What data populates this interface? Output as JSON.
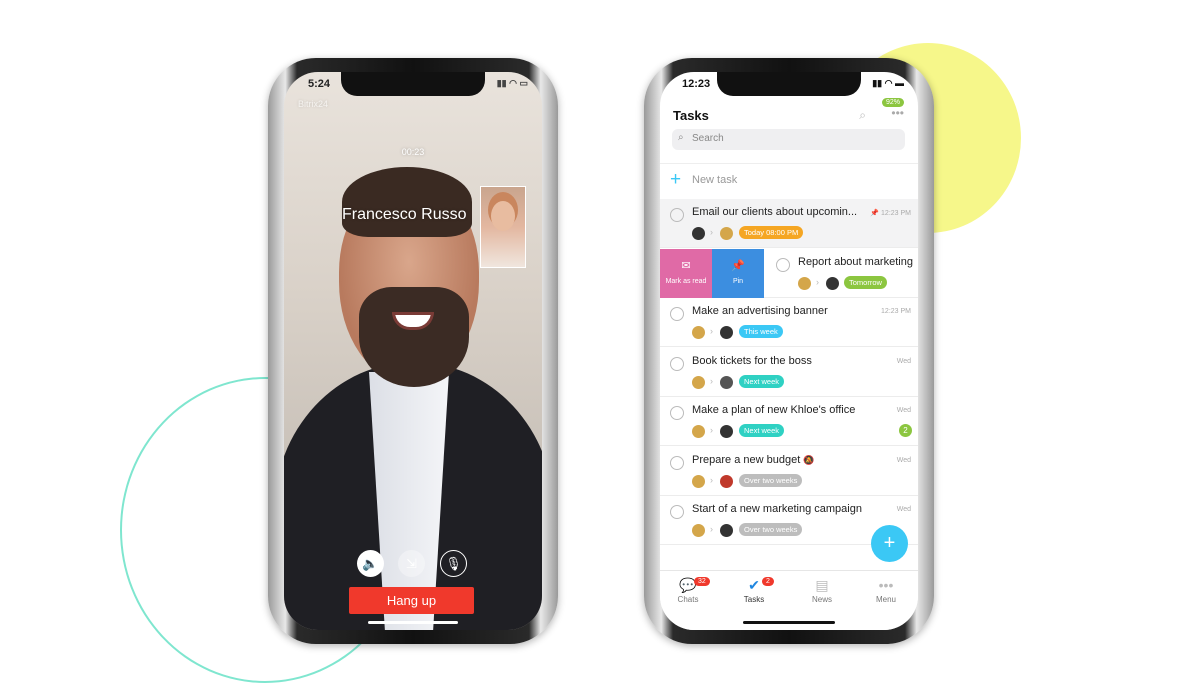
{
  "colors": {
    "accent": "#3bc8f5",
    "hangup": "#f0392c",
    "yellow_deco": "#f6f78a",
    "teal_deco": "#7fe6cf"
  },
  "call": {
    "time": "5:24",
    "app_label": "Bitrix24",
    "duration": "00:23",
    "caller": "Francesco Russo",
    "hangup_label": "Hang up",
    "buttons": [
      {
        "icon": "speaker-icon",
        "glyph": "🔈"
      },
      {
        "icon": "minimize-icon",
        "glyph": "⇲"
      },
      {
        "icon": "microphone-icon",
        "glyph": "🎙"
      }
    ]
  },
  "tasks": {
    "time": "12:23",
    "battery_badge": "92%",
    "title": "Tasks",
    "search_placeholder": "Search",
    "new_task": "New task",
    "swipe_actions": [
      {
        "label": "Mark as read",
        "color": "#e06aa6"
      },
      {
        "label": "Pin",
        "color": "#3c8ee0"
      }
    ],
    "items": [
      {
        "title": "Email our clients about upcomin...",
        "time": "12:23 PM",
        "pinned": true,
        "tag": "Today 08:00 PM",
        "tag_color": "#f5a623"
      },
      {
        "title": "Report about marketing",
        "time": "",
        "tag": "Tomorrow",
        "tag_color": "#8cc640"
      },
      {
        "title": "Make an advertising banner",
        "time": "12:23 PM",
        "tag": "This week",
        "tag_color": "#3bc8f5"
      },
      {
        "title": "Book tickets for the boss",
        "time": "Wed",
        "tag": "Next week",
        "tag_color": "#2fd1c3"
      },
      {
        "title": "Make a plan of new Khloe's office",
        "time": "Wed",
        "tag": "Next week",
        "tag_color": "#2fd1c3",
        "counter": "2"
      },
      {
        "title": "Prepare a new budget",
        "time": "Wed",
        "muted": true,
        "tag": "Over two weeks",
        "tag_color": "#bdbdbd"
      },
      {
        "title": "Start of a new marketing campaign",
        "time": "Wed",
        "tag": "Over two weeks",
        "tag_color": "#bdbdbd"
      }
    ],
    "tabs": [
      {
        "label": "Chats",
        "badge": "32",
        "icon": "chat-icon"
      },
      {
        "label": "Tasks",
        "badge": "2",
        "icon": "tasks-check-icon",
        "active": true
      },
      {
        "label": "News",
        "icon": "news-icon"
      },
      {
        "label": "Menu",
        "icon": "more-icon"
      }
    ]
  }
}
